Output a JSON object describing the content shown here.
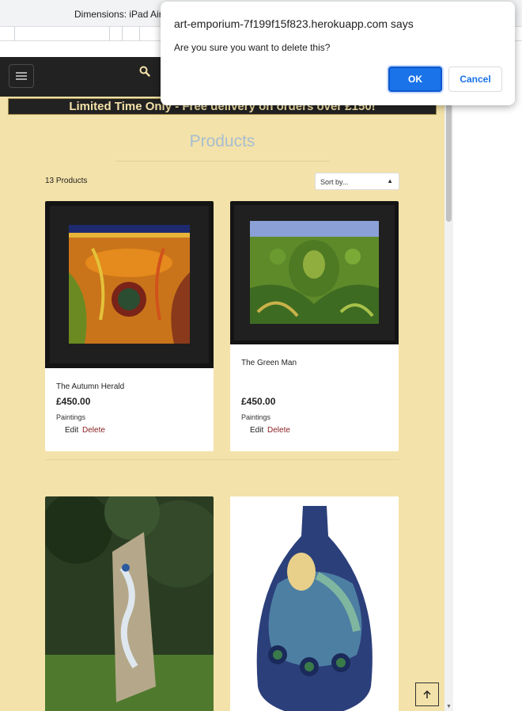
{
  "devtools": {
    "dimensions_text": "Dimensions: iPad Air"
  },
  "dialog": {
    "site": "art-emporium-7f199f15f823.herokuapp.com says",
    "message": "Are you sure you want to delete this?",
    "ok_label": "OK",
    "cancel_label": "Cancel"
  },
  "nav": {
    "menu_icon": "hamburger-icon",
    "search_icon": "search-icon"
  },
  "banner": {
    "text": "Limited Time Only - Free delivery on orders over £150!"
  },
  "page": {
    "title": "Products",
    "product_count": "13 Products",
    "sort_selected": "Sort by...",
    "back_to_top_icon": "arrow-up-icon"
  },
  "products": [
    {
      "name": "The Autumn Herald",
      "price": "£450.00",
      "category": "Paintings",
      "edit_label": "Edit",
      "delete_label": "Delete"
    },
    {
      "name": "The Green Man",
      "price": "£450.00",
      "category": "Paintings",
      "edit_label": "Edit",
      "delete_label": "Delete"
    },
    {
      "name": "",
      "price": "",
      "category": ""
    },
    {
      "name": "",
      "price": "",
      "category": ""
    }
  ],
  "colors": {
    "page_background": "#f3e2a9",
    "nav_background": "#222222",
    "title_color": "#a7bdd0",
    "delete_color": "#8b1e1e",
    "dialog_primary": "#1a73e8"
  }
}
